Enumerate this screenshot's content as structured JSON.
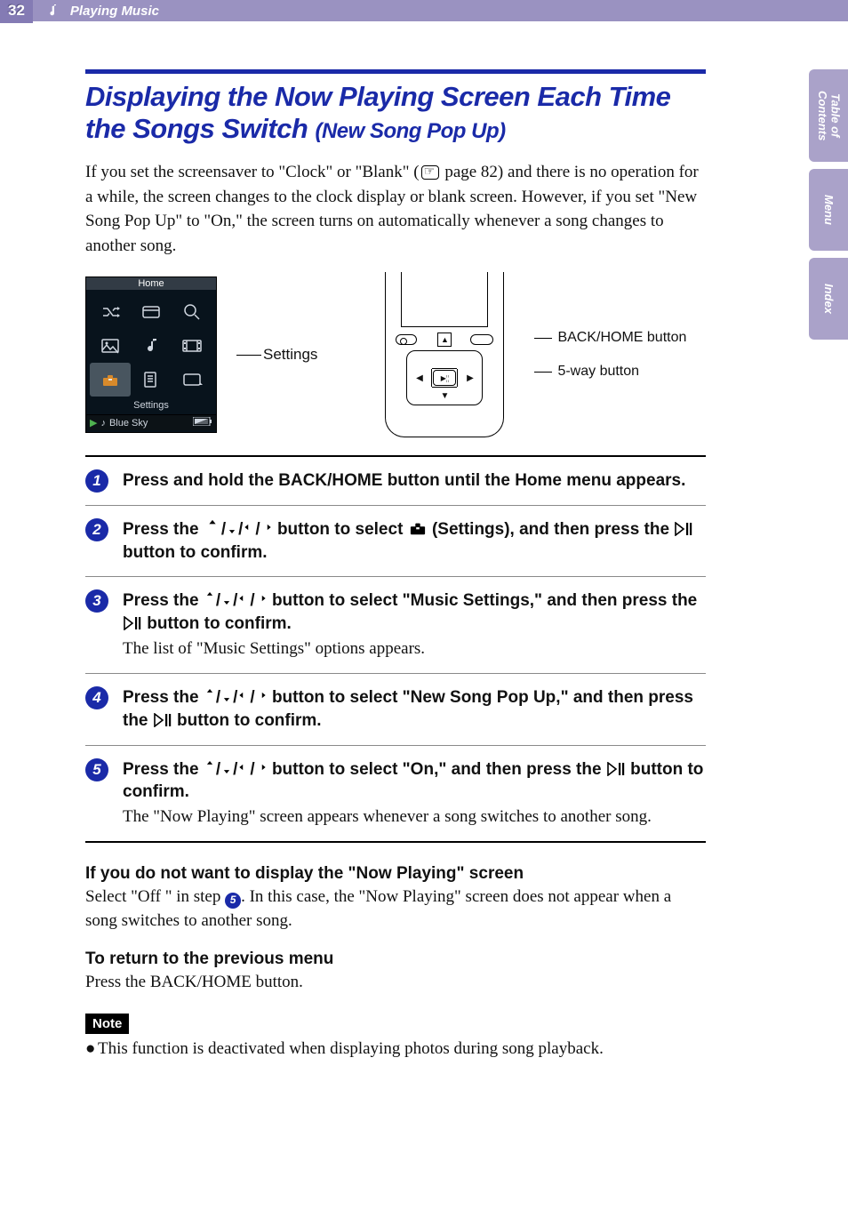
{
  "header": {
    "page_number": "32",
    "section": "Playing Music"
  },
  "side_tabs": {
    "toc": "Table of\nContents",
    "menu": "Menu",
    "index": "Index"
  },
  "title": {
    "main": "Displaying the Now Playing Screen Each Time the Songs Switch ",
    "sub": "(New Song Pop Up)"
  },
  "intro": "If you set the screensaver to \"Clock\" or \"Blank\" (     page 82) and there is no operation for a while, the screen changes to the clock display or blank screen. However, if you set \"New Song Pop Up\" to \"On,\" the screen turns on automatically whenever a song changes to another song.",
  "figure": {
    "home_title": "Home",
    "menu_label": "Settings",
    "now_playing_song": "Blue Sky",
    "callout_settings": "Settings",
    "callout_back": "BACK/HOME button",
    "callout_5way": "5-way button"
  },
  "steps": [
    {
      "num": "1",
      "head": "Press and hold the BACK/HOME button until the Home menu appears."
    },
    {
      "num": "2",
      "head_pre": "Press the ",
      "head_mid": " button to select ",
      "head_post1": " (Settings), and then press the ",
      "head_post2": " button to confirm."
    },
    {
      "num": "3",
      "head_pre": "Press the ",
      "head_mid": " button to select \"Music Settings,\" and then press the ",
      "head_post": " button to confirm.",
      "body": "The list of \"Music Settings\" options appears."
    },
    {
      "num": "4",
      "head_pre": "Press the ",
      "head_mid": " button to select \"New Song Pop Up,\" and then press the ",
      "head_post": " button to confirm."
    },
    {
      "num": "5",
      "head_pre": "Press the ",
      "head_mid": " button to select \"On,\" and then press the ",
      "head_post": " button to confirm.",
      "body": "The \"Now Playing\" screen appears whenever a song switches to another song."
    }
  ],
  "sub1": {
    "head": "If you do not want to display the \"Now Playing\" screen",
    "body_pre": "Select \"Off \" in step ",
    "body_badge": "5",
    "body_post": ". In this case, the \"Now Playing\" screen does not appear when a song switches to another song."
  },
  "sub2": {
    "head": "To return to the previous menu",
    "body": "Press the BACK/HOME button."
  },
  "note": {
    "label": "Note",
    "item": "This function is deactivated when displaying photos during song playback."
  }
}
